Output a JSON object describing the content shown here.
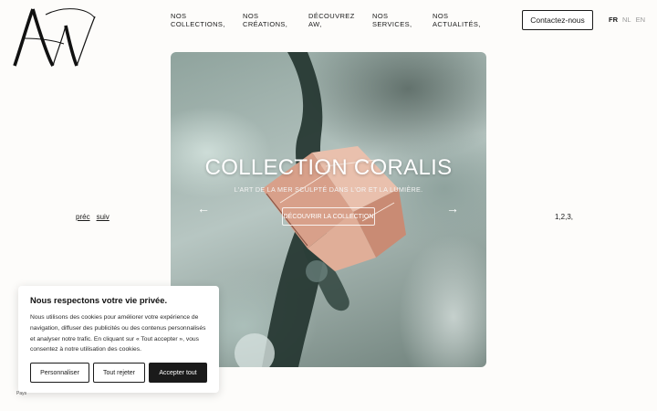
{
  "logo": {
    "icon": "aw-monogram-logo"
  },
  "nav": [
    {
      "line1": "NOS",
      "line2": "COLLECTIONS,"
    },
    {
      "line1": "NOS",
      "line2": "CRÉATIONS,"
    },
    {
      "line1": "DÉCOUVREZ",
      "line2": "AW,"
    },
    {
      "line1": "NOS",
      "line2": "SERVICES,"
    },
    {
      "line1": "NOS",
      "line2": "ACTUALITÉS,"
    }
  ],
  "header": {
    "contact_label": "Contactez-nous",
    "languages": [
      "FR",
      "NL",
      "EN"
    ],
    "active_language": "FR"
  },
  "hero": {
    "title": "COLLECTION CORALIS",
    "subtitle": "L'ART DE LA MER SCULPTÉ DANS L'OR ET LA LUMIÈRE.",
    "cta_label": "DÉCOUVRIR LA COLLECTION",
    "prev_icon": "arrow-left-icon",
    "next_icon": "arrow-right-icon"
  },
  "slider": {
    "prev_label": "préc",
    "next_label": "suiv",
    "pages": "1,2,3,"
  },
  "cookie": {
    "title": "Nous respectons votre vie privée.",
    "text": "Nous utilisons des cookies pour améliorer votre expérience de navigation, diffuser des publicités ou des contenus personnalisés et analyser notre trafic. En cliquant sur « Tout accepter », vous consentez à notre utilisation des cookies.",
    "customize_label": "Personnaliser",
    "reject_label": "Tout rejeter",
    "accept_label": "Accepter tout"
  },
  "footer": {
    "small_text": "Pays"
  },
  "colors": {
    "background": "#fdfcfa",
    "text": "#1a1a1a",
    "accent_dark": "#1a1a1a",
    "ring_gold": "#d8a08a"
  }
}
